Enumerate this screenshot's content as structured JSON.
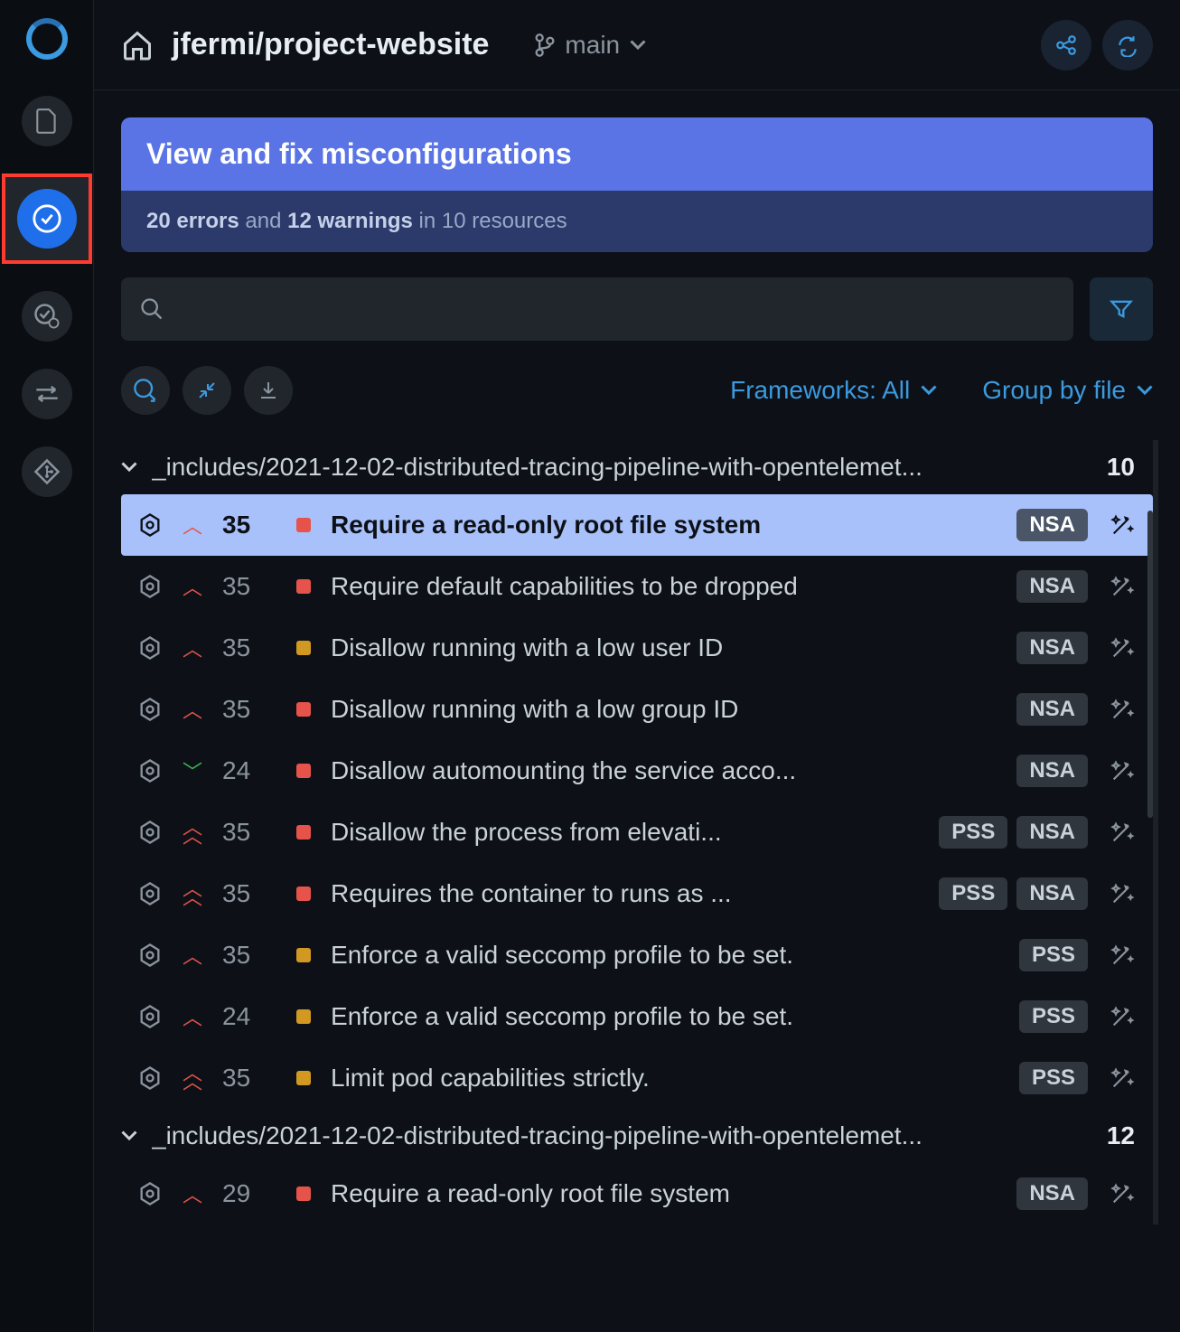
{
  "repo": "jfermi/project-website",
  "branch": "main",
  "banner": {
    "title": "View and fix misconfigurations",
    "errors": "20 errors",
    "and": " and ",
    "warnings": "12 warnings",
    "suffix": " in 10 resources"
  },
  "toolbar": {
    "frameworks": "Frameworks: All",
    "groupby": "Group by file"
  },
  "groups": [
    {
      "name": "_includes/2021-12-02-distributed-tracing-pipeline-with-opentelemet...",
      "count": "10",
      "issues": [
        {
          "line": "35",
          "sev": "error",
          "title": "Require a read-only root file system",
          "badges": [
            "NSA"
          ],
          "chev": "up",
          "selected": true
        },
        {
          "line": "35",
          "sev": "error",
          "title": "Require default capabilities to be dropped",
          "badges": [
            "NSA"
          ],
          "chev": "up"
        },
        {
          "line": "35",
          "sev": "warn",
          "title": "Disallow running with a low user ID",
          "badges": [
            "NSA"
          ],
          "chev": "up"
        },
        {
          "line": "35",
          "sev": "error",
          "title": "Disallow running with a low group ID",
          "badges": [
            "NSA"
          ],
          "chev": "up"
        },
        {
          "line": "24",
          "sev": "error",
          "title": "Disallow automounting the service acco...",
          "badges": [
            "NSA"
          ],
          "chev": "down"
        },
        {
          "line": "35",
          "sev": "error",
          "title": "Disallow the process from elevati...",
          "badges": [
            "PSS",
            "NSA"
          ],
          "chev": "double"
        },
        {
          "line": "35",
          "sev": "error",
          "title": "Requires the container to runs as ...",
          "badges": [
            "PSS",
            "NSA"
          ],
          "chev": "double"
        },
        {
          "line": "35",
          "sev": "warn",
          "title": "Enforce a valid seccomp profile to be set.",
          "badges": [
            "PSS"
          ],
          "chev": "up"
        },
        {
          "line": "24",
          "sev": "warn",
          "title": "Enforce a valid seccomp profile to be set.",
          "badges": [
            "PSS"
          ],
          "chev": "up"
        },
        {
          "line": "35",
          "sev": "warn",
          "title": "Limit pod capabilities strictly.",
          "badges": [
            "PSS"
          ],
          "chev": "double"
        }
      ]
    },
    {
      "name": "_includes/2021-12-02-distributed-tracing-pipeline-with-opentelemet...",
      "count": "12",
      "issues": [
        {
          "line": "29",
          "sev": "error",
          "title": "Require a read-only root file system",
          "badges": [
            "NSA"
          ],
          "chev": "up"
        }
      ]
    }
  ]
}
